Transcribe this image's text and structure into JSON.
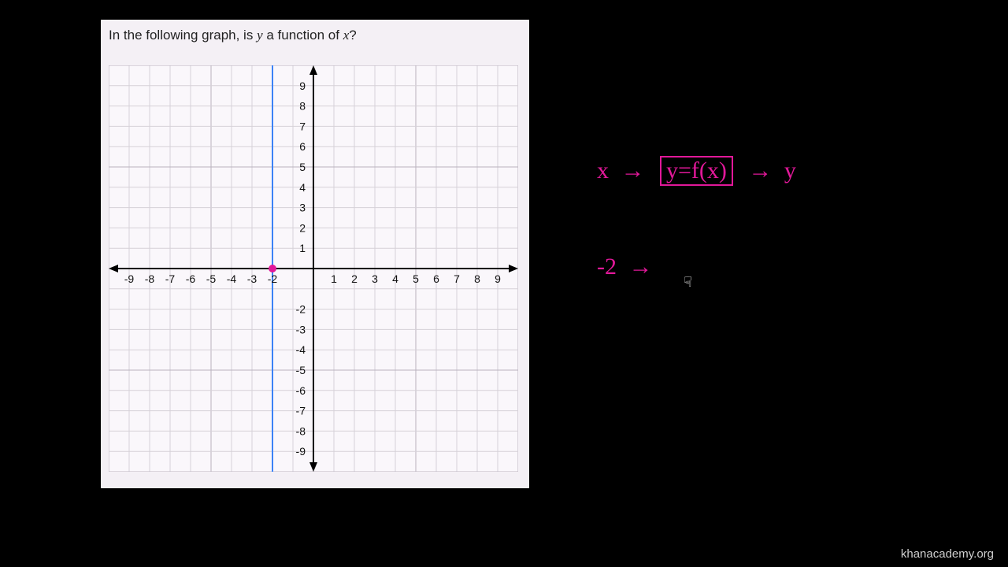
{
  "question": {
    "prefix": "In the following graph, is ",
    "var1": "y",
    "mid": " a function of ",
    "var2": "x",
    "suffix": "?"
  },
  "chart_data": {
    "type": "line",
    "title": "",
    "xlabel": "",
    "ylabel": "",
    "xlim": [
      -10,
      10
    ],
    "ylim": [
      -10,
      10
    ],
    "xticks": [
      -9,
      -8,
      -7,
      -6,
      -5,
      -4,
      -3,
      -2,
      1,
      2,
      3,
      4,
      5,
      6,
      7,
      8,
      9
    ],
    "yticks": [
      9,
      8,
      7,
      6,
      5,
      4,
      3,
      2,
      1,
      -2,
      -3,
      -4,
      -5,
      -6,
      -7,
      -8,
      -9
    ],
    "grid": true,
    "series": [
      {
        "name": "vertical-line",
        "type": "vertical",
        "x": -2,
        "note": "x = -2, all y"
      }
    ],
    "points": [
      {
        "x": -2,
        "y": 0,
        "label": "(-2,0)"
      }
    ]
  },
  "annotations": {
    "fn_x": "x",
    "fn_box": "y=f(x)",
    "fn_y": "y",
    "ex_in": "-2"
  },
  "attribution": "khanacademy.org",
  "cursor_glyph": "☟"
}
